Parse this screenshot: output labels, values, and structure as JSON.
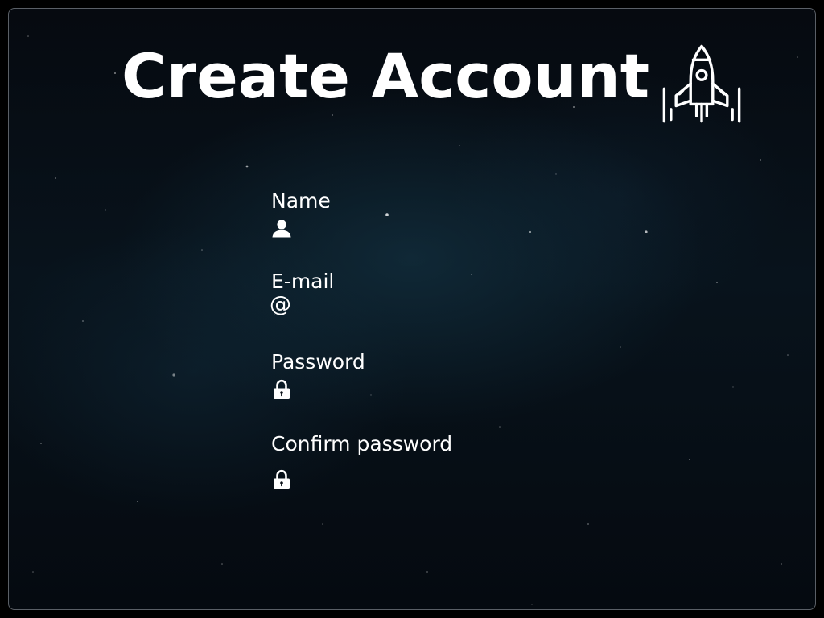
{
  "page": {
    "title": "Create Account",
    "title_icon": "rocket-icon",
    "colors": {
      "background": "#060a10",
      "text": "#ffffff",
      "frame_border": "#5a5f66"
    }
  },
  "form": {
    "fields": [
      {
        "label": "Name",
        "icon": "user-icon",
        "value": "",
        "placeholder": ""
      },
      {
        "label": "E-mail",
        "icon": "at-icon",
        "icon_glyph": "@",
        "value": "",
        "placeholder": ""
      },
      {
        "label": "Password",
        "icon": "lock-icon",
        "value": "",
        "placeholder": ""
      },
      {
        "label": "Confirm password",
        "icon": "lock-icon",
        "value": "",
        "placeholder": ""
      }
    ]
  }
}
